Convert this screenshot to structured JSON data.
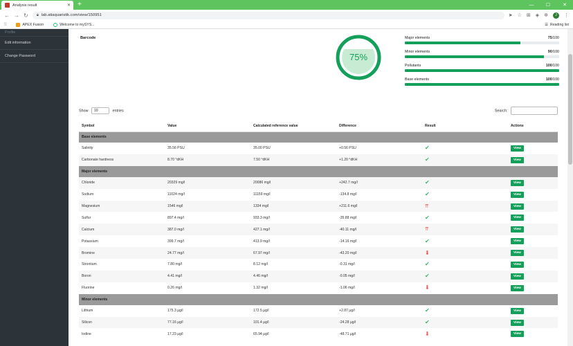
{
  "browser": {
    "tab_title": "Analysis result",
    "url": "lab.atiaquaristik.com/view/150951",
    "bookmarks": [
      "APEX Fusion",
      "Welcome to mySYS..."
    ],
    "reading_list": "Reading list",
    "avatar_letter": "J"
  },
  "sidebar": {
    "items": [
      "Profile",
      "Edit information",
      "Change Password"
    ]
  },
  "summary": {
    "barcode_label": "Barcode",
    "gauge_percent": 75,
    "gauge_label": "75%",
    "scores": [
      {
        "name": "Major elements",
        "value": "75",
        "max": "/100",
        "fraction": 0.75
      },
      {
        "name": "Minor elements",
        "value": "90",
        "max": "/100",
        "fraction": 0.9
      },
      {
        "name": "Pollutants",
        "value": "100",
        "max": "/100",
        "fraction": 1.0
      },
      {
        "name": "Base elements",
        "value": "100",
        "max": "/100",
        "fraction": 1.0
      }
    ],
    "colors": {
      "accent": "#14a05a",
      "gauge_fill": "#c8ecd3"
    }
  },
  "table_controls": {
    "show": "Show",
    "length_value": "10",
    "entries": "entries",
    "search_label": "Search:"
  },
  "table": {
    "headers": [
      "Symbol",
      "Value",
      "Calculated reference value",
      "Difference",
      "Result",
      "Actions"
    ],
    "action_label": "View",
    "groups": [
      {
        "name": "Base elements",
        "rows": [
          {
            "symbol": "Salinity",
            "value": "35.56 PSU",
            "ref": "35.00 PSU",
            "diff": "+0.56 PSU",
            "result": "check-icon"
          },
          {
            "symbol": "Carbonate hardness",
            "value": "8.70 °dKH",
            "ref": "7.50 °dKH",
            "diff": "+1.20 °dKH",
            "result": "check-icon"
          }
        ]
      },
      {
        "name": "Major elements",
        "rows": [
          {
            "symbol": "Chloride",
            "value": "20329 mg/l",
            "ref": "20086 mg/l",
            "diff": "+242.7 mg/l",
            "result": "check-icon"
          },
          {
            "symbol": "Sodium",
            "value": "11024 mg/l",
            "ref": "11159 mg/l",
            "diff": "-134.8 mg/l",
            "result": "check-icon"
          },
          {
            "symbol": "Magnesium",
            "value": "1546 mg/l",
            "ref": "1334 mg/l",
            "diff": "+211.6 mg/l",
            "result": "double-up-icon"
          },
          {
            "symbol": "Sulfur",
            "value": "897.4 mg/l",
            "ref": "933.3 mg/l",
            "diff": "-35.88 mg/l",
            "result": "check-icon"
          },
          {
            "symbol": "Calcium",
            "value": "387.0 mg/l",
            "ref": "427.1 mg/l",
            "diff": "-40.11 mg/l",
            "result": "double-up-icon"
          },
          {
            "symbol": "Potassium",
            "value": "399.7 mg/l",
            "ref": "413.9 mg/l",
            "diff": "-14.16 mg/l",
            "result": "check-icon"
          },
          {
            "symbol": "Bromine",
            "value": "24.77 mg/l",
            "ref": "67.97 mg/l",
            "diff": "-43.20 mg/l",
            "result": "down-icon"
          },
          {
            "symbol": "Strontium",
            "value": "7.80 mg/l",
            "ref": "8.12 mg/l",
            "diff": "-0.31 mg/l",
            "result": "check-icon"
          },
          {
            "symbol": "Boron",
            "value": "4.41 mg/l",
            "ref": "4.46 mg/l",
            "diff": "-0.05 mg/l",
            "result": "check-icon"
          },
          {
            "symbol": "Fluorine",
            "value": "0.26 mg/l",
            "ref": "1.32 mg/l",
            "diff": "-1.06 mg/l",
            "result": "down-icon"
          }
        ]
      },
      {
        "name": "Minor elements",
        "rows": [
          {
            "symbol": "Lithium",
            "value": "175.3 µg/l",
            "ref": "172.5 µg/l",
            "diff": "+2.87 µg/l",
            "result": "check-icon"
          },
          {
            "symbol": "Silicon",
            "value": "77.16 µg/l",
            "ref": "101.4 µg/l",
            "diff": "-24.28 µg/l",
            "result": "check-icon"
          },
          {
            "symbol": "Iodine",
            "value": "17.23 µg/l",
            "ref": "65.94 µg/l",
            "diff": "-48.71 µg/l",
            "result": "down-icon"
          }
        ]
      }
    ]
  }
}
